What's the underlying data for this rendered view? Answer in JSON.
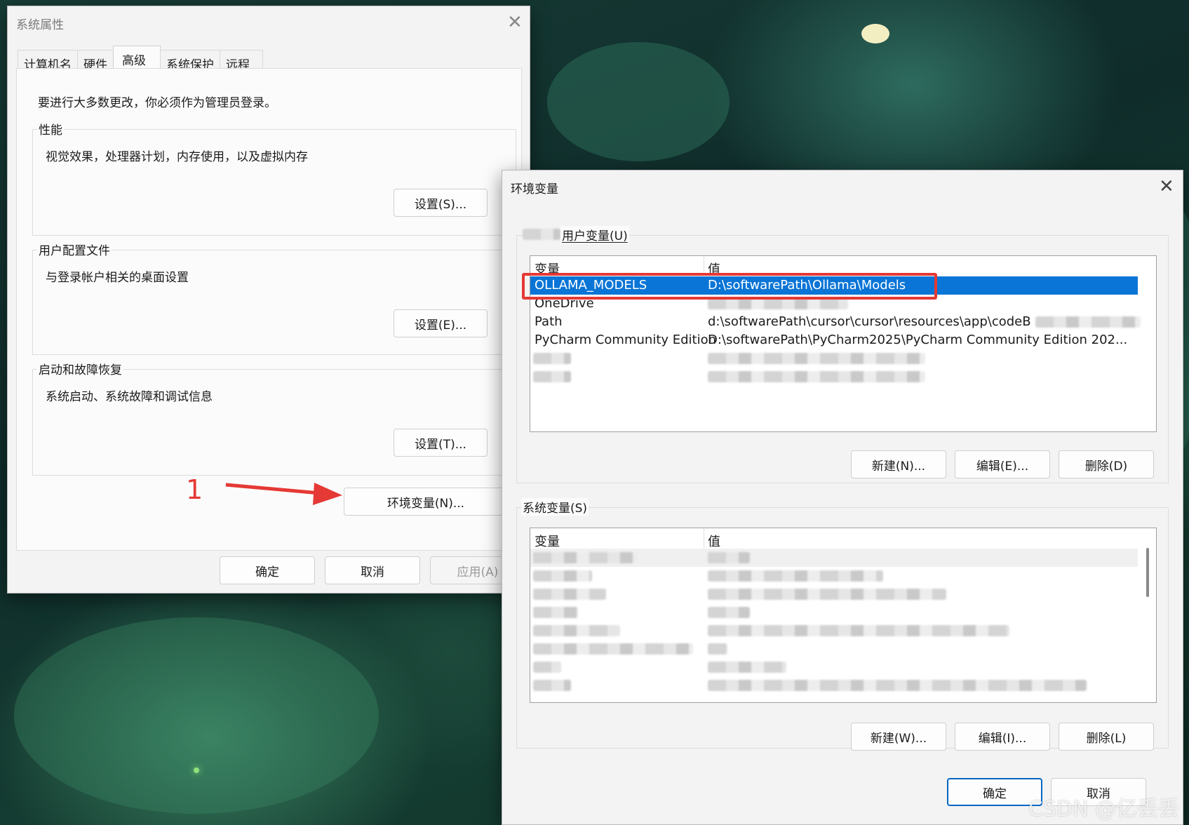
{
  "system_properties": {
    "title": "系统属性",
    "tabs": [
      "计算机名",
      "硬件",
      "高级",
      "系统保护",
      "远程"
    ],
    "active_tab": "高级",
    "admin_notice": "要进行大多数更改，你必须作为管理员登录。",
    "performance": {
      "label": "性能",
      "description": "视觉效果，处理器计划，内存使用，以及虚拟内存",
      "button": "设置(S)..."
    },
    "user_profiles": {
      "label": "用户配置文件",
      "description": "与登录帐户相关的桌面设置",
      "button": "设置(E)..."
    },
    "startup_recovery": {
      "label": "启动和故障恢复",
      "description": "系统启动、系统故障和调试信息",
      "button": "设置(T)..."
    },
    "env_button": "环境变量(N)...",
    "ok": "确定",
    "cancel": "取消",
    "apply": "应用(A)"
  },
  "annotation_step": "1",
  "env_vars": {
    "title": "环境变量",
    "user_section_label": "用户变量(U)",
    "headers": {
      "name": "变量",
      "value": "值"
    },
    "user_vars": [
      {
        "name": "OLLAMA_MODELS",
        "value": "D:\\softwarePath\\Ollama\\Models",
        "selected": true
      },
      {
        "name": "OneDrive",
        "value": ""
      },
      {
        "name": "Path",
        "value": "d:\\softwarePath\\cursor\\cursor\\resources\\app\\codeB"
      },
      {
        "name": "PyCharm Community Edition",
        "value": "D:\\softwarePath\\PyCharm2025\\PyCharm Community Edition 202..."
      }
    ],
    "user_buttons": {
      "new": "新建(N)...",
      "edit": "编辑(E)...",
      "delete": "删除(D)"
    },
    "system_section_label": "系统变量(S)",
    "system_buttons": {
      "new": "新建(W)...",
      "edit": "编辑(I)...",
      "delete": "删除(L)"
    },
    "ok": "确定",
    "cancel": "取消"
  },
  "watermark": "CSDN @亿丢丢",
  "colors": {
    "selection": "#0a75d6",
    "highlight_box": "#e53935",
    "annotation_arrow": "#e53935",
    "primary_border": "#0067c0"
  }
}
